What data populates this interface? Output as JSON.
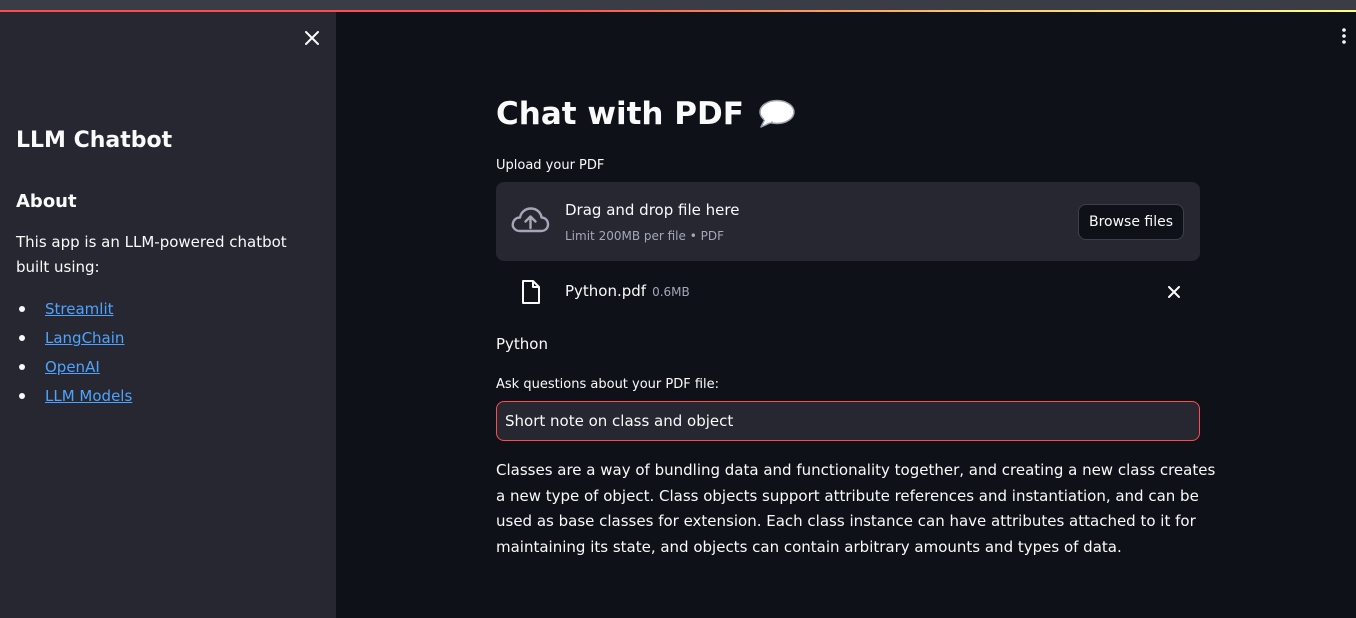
{
  "sidebar": {
    "title": "LLM Chatbot",
    "about_heading": "About",
    "description": "This app is an LLM-powered chatbot built using:",
    "links": [
      "Streamlit",
      "LangChain",
      "OpenAI",
      "LLM Models"
    ]
  },
  "main": {
    "title": "Chat with PDF",
    "title_emoji": "speech-balloon",
    "upload_label": "Upload your PDF",
    "dropzone": {
      "text": "Drag and drop file here",
      "subtext": "Limit 200MB per file • PDF",
      "browse_label": "Browse files"
    },
    "file": {
      "name": "Python.pdf",
      "size": "0.6MB"
    },
    "doc_name": "Python",
    "ask_label": "Ask questions about your PDF file:",
    "ask_value": "Short note on class and object",
    "answer": "Classes are a way of bundling data and functionality together, and creating a new class creates a new type of object. Class objects support attribute references and instantiation, and can be used as base classes for extension. Each class instance can have attributes attached to it for maintaining its state, and objects can contain arbitrary amounts and types of data."
  },
  "colors": {
    "background": "#0e1117",
    "sidebar": "#262730",
    "accent": "#ff4b4b",
    "link": "#4ea3ff"
  }
}
